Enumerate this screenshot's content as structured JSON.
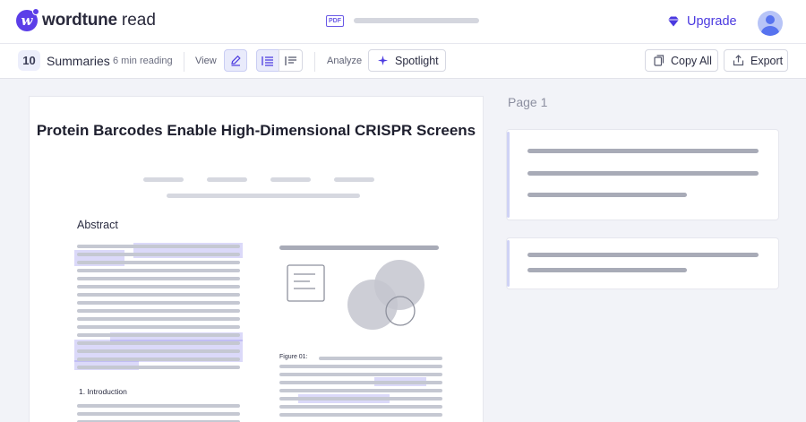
{
  "header": {
    "logo_word": "wordtune",
    "logo_read": "read",
    "logo_mark": "w",
    "pdf_badge": "PDF",
    "upgrade_label": "Upgrade",
    "avatar_icon": "user-avatar-icon"
  },
  "toolbar": {
    "summary_count": "10",
    "summaries_label": "Summaries",
    "reading_time": "6 min reading",
    "view_label": "View",
    "analyze_label": "Analyze",
    "spotlight_label": "Spotlight",
    "copy_all_label": "Copy All",
    "export_label": "Export"
  },
  "document": {
    "title": "Protein Barcodes Enable High-Dimensional CRISPR Screens",
    "abstract_heading": "Abstract",
    "figure_caption": "Figure 01:",
    "introduction_heading": "1. Introduction"
  },
  "summary_panel": {
    "page_label": "Page 1"
  },
  "colors": {
    "brand": "#5b3ee8",
    "accent": "#4b3ae0",
    "highlight": "#7c76e8",
    "background": "#f2f3f8"
  }
}
